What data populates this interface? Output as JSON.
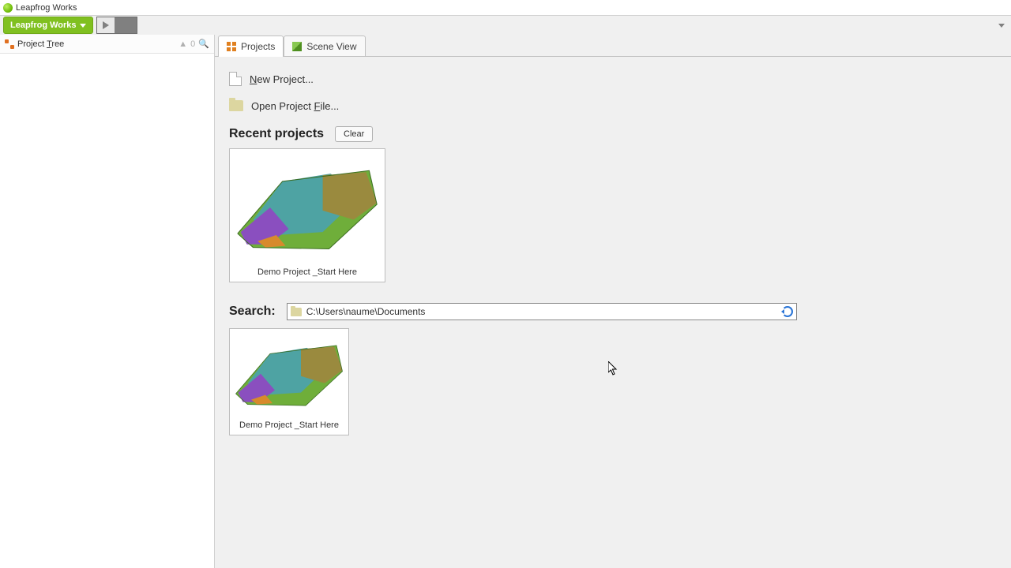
{
  "window": {
    "title": "Leapfrog Works"
  },
  "toolbar": {
    "menu_label": "Leapfrog Works",
    "play_tooltip": "Run"
  },
  "left_panel": {
    "title": "Project Tree",
    "counter": "0"
  },
  "tabs": {
    "projects": "Projects",
    "scene_view": "Scene View",
    "active": "projects"
  },
  "page": {
    "new_project": "New Project...",
    "open_project": "Open Project File...",
    "recent_heading": "Recent projects",
    "clear_button": "Clear",
    "recent": [
      {
        "name": "Demo Project _Start Here"
      }
    ],
    "search_label": "Search:",
    "search_path": "C:\\Users\\naume\\Documents",
    "search_results": [
      {
        "name": "Demo Project _Start Here"
      }
    ]
  }
}
